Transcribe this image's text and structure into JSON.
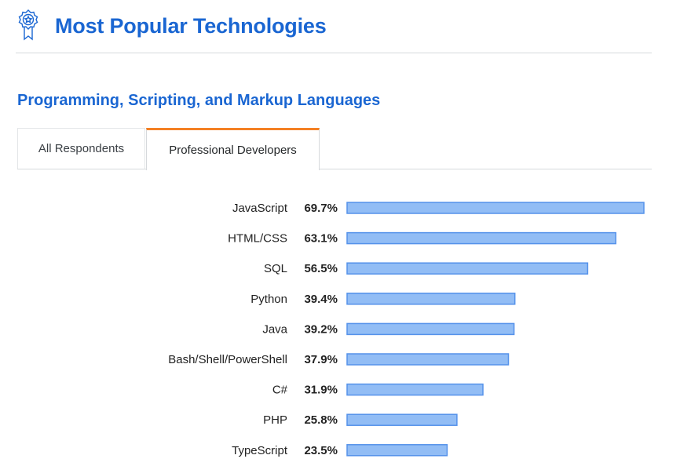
{
  "header": {
    "title": "Most Popular Technologies",
    "icon": "badge-icon",
    "accent_color": "#1a66d2"
  },
  "section": {
    "title": "Programming, Scripting, and Markup Languages"
  },
  "tabs": [
    {
      "label": "All Respondents",
      "active": false
    },
    {
      "label": "Professional Developers",
      "active": true
    }
  ],
  "tab_active_color": "#f48024",
  "chart_data": {
    "type": "bar",
    "orientation": "horizontal",
    "categories": [
      "JavaScript",
      "HTML/CSS",
      "SQL",
      "Python",
      "Java",
      "Bash/Shell/PowerShell",
      "C#",
      "PHP",
      "TypeScript"
    ],
    "values": [
      69.7,
      63.1,
      56.5,
      39.4,
      39.2,
      37.9,
      31.9,
      25.8,
      23.5
    ],
    "value_labels": [
      "69.7%",
      "63.1%",
      "56.5%",
      "39.4%",
      "39.2%",
      "37.9%",
      "31.9%",
      "25.8%",
      "23.5%"
    ],
    "bar_fill": "#92bdf5",
    "bar_stroke": "#5592ea",
    "grid": false
  }
}
